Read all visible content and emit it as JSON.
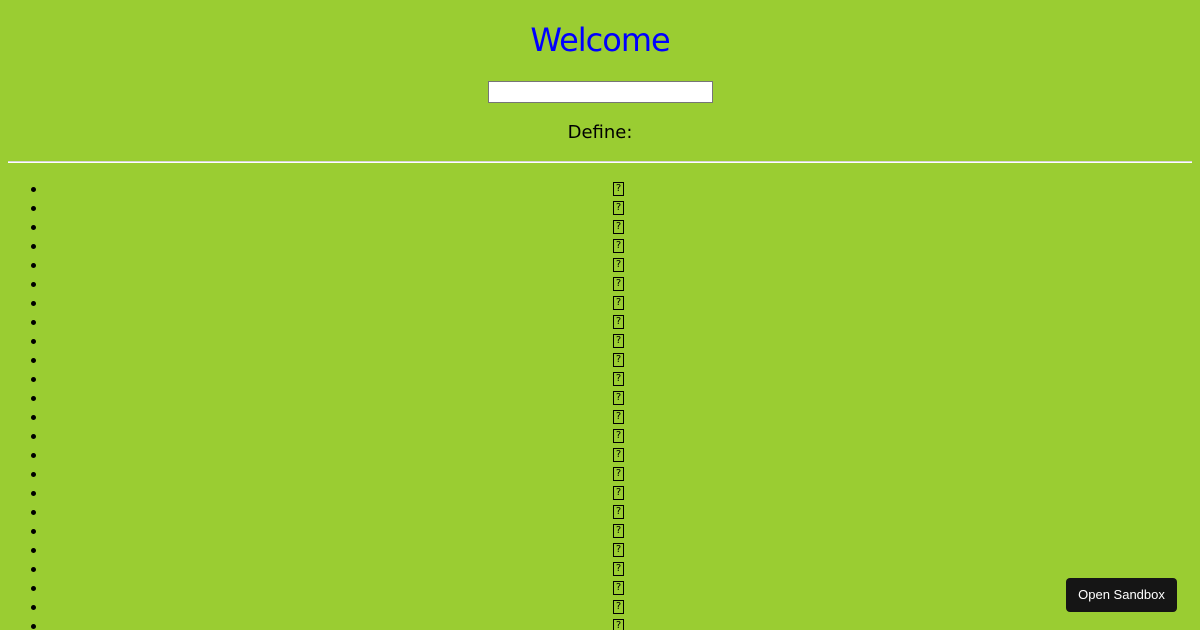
{
  "header": {
    "title": "Welcome"
  },
  "search": {
    "value": "",
    "placeholder": ""
  },
  "define": {
    "label": "Define:"
  },
  "word_list": {
    "items": [
      {
        "text": "",
        "icon": "?"
      },
      {
        "text": "",
        "icon": "?"
      },
      {
        "text": "",
        "icon": "?"
      },
      {
        "text": "",
        "icon": "?"
      },
      {
        "text": "",
        "icon": "?"
      },
      {
        "text": "",
        "icon": "?"
      },
      {
        "text": "",
        "icon": "?"
      },
      {
        "text": "",
        "icon": "?"
      },
      {
        "text": "",
        "icon": "?"
      },
      {
        "text": "",
        "icon": "?"
      },
      {
        "text": "",
        "icon": "?"
      },
      {
        "text": "",
        "icon": "?"
      },
      {
        "text": "",
        "icon": "?"
      },
      {
        "text": "",
        "icon": "?"
      },
      {
        "text": "",
        "icon": "?"
      },
      {
        "text": "",
        "icon": "?"
      },
      {
        "text": "",
        "icon": "?"
      },
      {
        "text": "",
        "icon": "?"
      },
      {
        "text": "",
        "icon": "?"
      },
      {
        "text": "",
        "icon": "?"
      },
      {
        "text": "",
        "icon": "?"
      },
      {
        "text": "",
        "icon": "?"
      },
      {
        "text": "",
        "icon": "?"
      },
      {
        "text": "",
        "icon": "?"
      }
    ]
  },
  "footer": {
    "sandbox_label": "Open Sandbox"
  },
  "colors": {
    "background": "#9acd32",
    "title": "#0000ff",
    "button_bg": "#151515"
  }
}
